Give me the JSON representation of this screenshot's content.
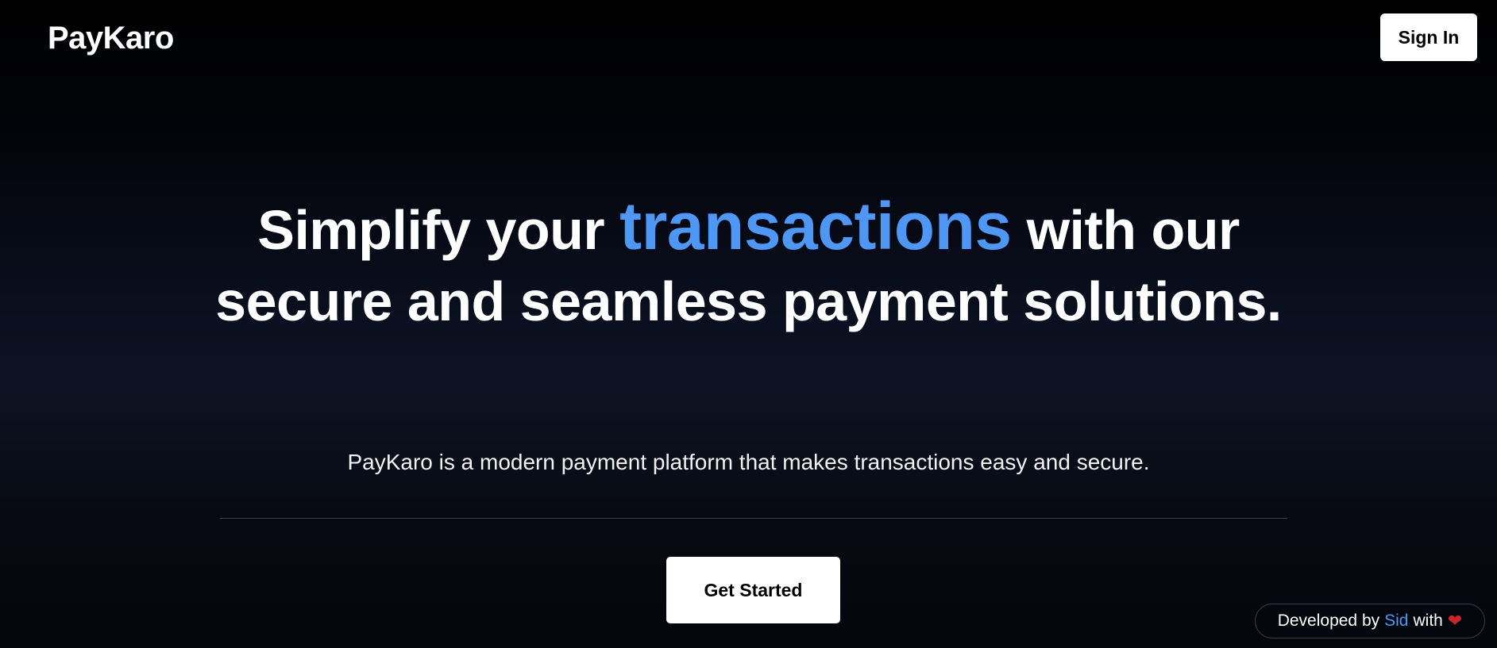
{
  "navbar": {
    "brand": "PayKaro",
    "signin_label": "Sign In"
  },
  "hero": {
    "headline_pre": "Simplify your ",
    "headline_accent": "transactions",
    "headline_post": " with our secure and seamless payment solutions.",
    "subtitle": "PayKaro is a modern payment platform that makes transactions easy and secure.",
    "cta_label": "Get Started"
  },
  "footer_badge": {
    "prefix": "Developed by",
    "author": "Sid",
    "suffix": "with",
    "icon": "heart-icon"
  },
  "colors": {
    "accent": "#4f97f5",
    "heart": "#c8252d",
    "background_dark": "#000000",
    "background_mid": "#0d1322"
  }
}
